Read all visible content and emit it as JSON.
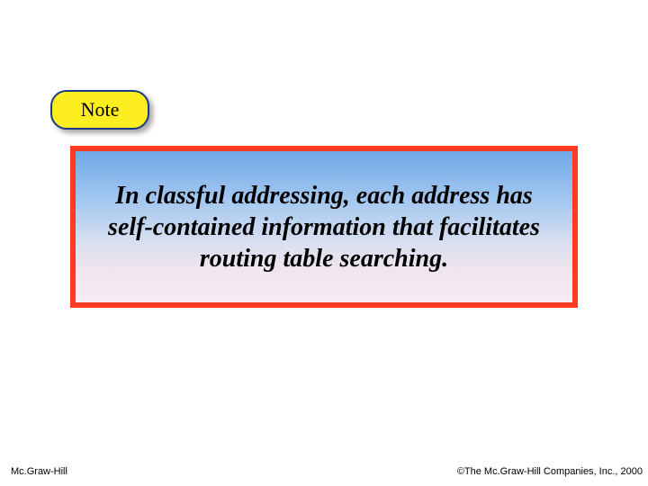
{
  "note_label": "Note",
  "body_text": "In classful addressing, each address has self-contained information that facilitates routing table searching.",
  "footer": {
    "left": "Mc.Graw-Hill",
    "right": "©The Mc.Graw-Hill Companies, Inc., 2000"
  }
}
